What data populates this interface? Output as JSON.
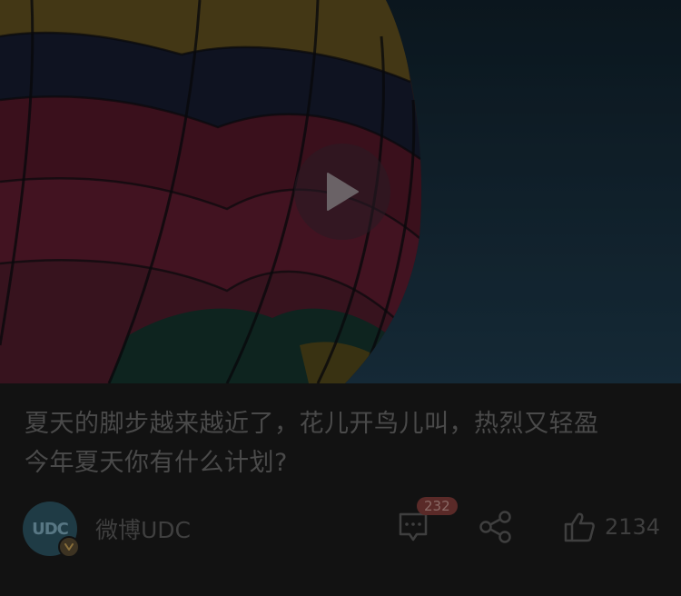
{
  "post": {
    "caption_line1": "夏天的脚步越来越近了，花儿开鸟儿叫，热烈又轻盈",
    "caption_line2": "今年夏天你有什么计划?"
  },
  "author": {
    "avatar_text": "UDC",
    "name": "微博UDC"
  },
  "actions": {
    "comment_count": "232",
    "like_count": "2134"
  },
  "colors": {
    "overlay_background": "#121212",
    "text_dim": "#4a4a4a",
    "badge_red": "#5a2a28"
  },
  "icons": {
    "play": "play-triangle",
    "comment": "chat-bubble",
    "share": "share-nodes",
    "like": "thumbs-up"
  }
}
